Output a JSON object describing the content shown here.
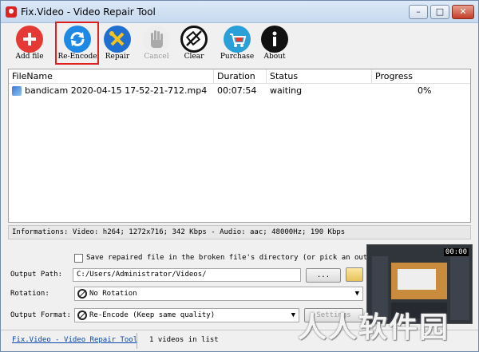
{
  "window": {
    "title": "Fix.Video - Video Repair Tool",
    "controls": [
      "–",
      "□",
      "✕"
    ]
  },
  "toolbar": {
    "add_file": "Add file",
    "re_encode": "Re-Encode",
    "repair": "Repair",
    "cancel": "Cancel",
    "clear": "Clear",
    "purchase": "Purchase",
    "about": "About"
  },
  "list": {
    "columns": [
      "FileName",
      "Duration",
      "Status",
      "Progress"
    ],
    "rows": [
      {
        "filename": "bandicam 2020-04-15 17-52-21-712.mp4",
        "duration": "00:07:54",
        "status": "waiting",
        "progress": "0%"
      }
    ]
  },
  "info": {
    "text": "Informations:  Video: h264; 1272x716; 342 Kbps - Audio: aac; 48000Hz; 190 Kbps"
  },
  "settings": {
    "save_checkbox_label": "Save repaired file in the broken file's directory (or pick an output p",
    "save_checked": false,
    "output_path_label": "Output Path:",
    "output_path_value": "C:/Users/Administrator/Videos/",
    "browse_label": "...",
    "rotation_label": "Rotation:",
    "rotation_value": "No Rotation",
    "output_format_label": "Output Format:",
    "output_format_value": "Re-Encode (Keep same quality)",
    "settings_button": "Settings"
  },
  "preview": {
    "time": "00:00"
  },
  "status": {
    "link": "Fix.Video - Video Repair Tool",
    "count": "1 videos in list"
  },
  "watermark": "人人软件园",
  "colors": {
    "add": "#e53935",
    "reencode": "#1e88e5",
    "repair": "#1f6fd0",
    "purchase": "#2aa0d8",
    "highlight": "#e02020"
  }
}
